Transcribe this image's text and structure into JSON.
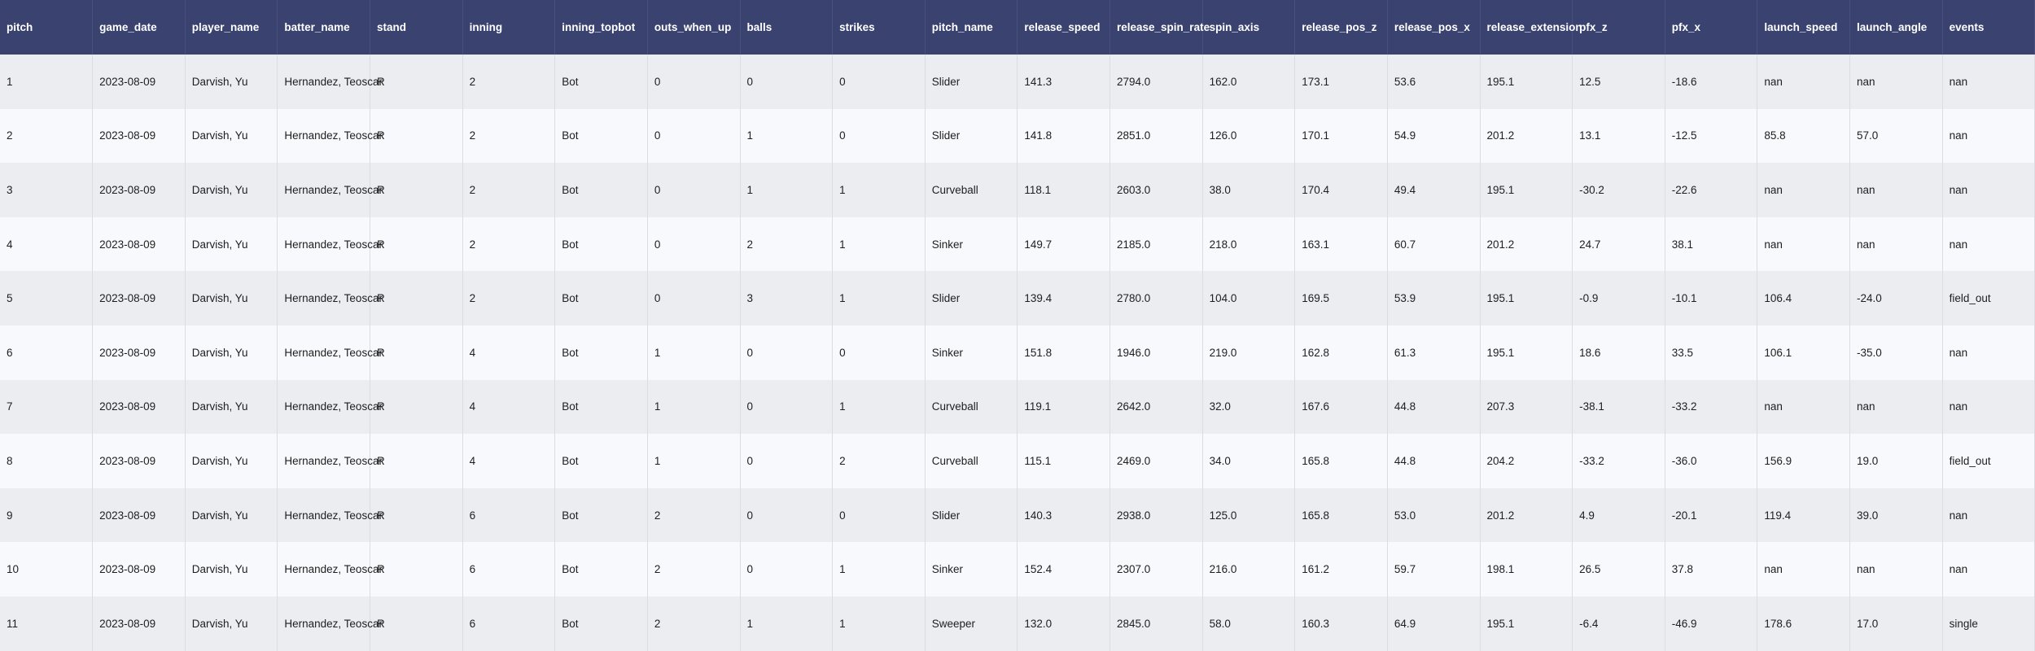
{
  "table": {
    "columns": [
      "pitch",
      "game_date",
      "player_name",
      "batter_name",
      "stand",
      "inning",
      "inning_topbot",
      "outs_when_up",
      "balls",
      "strikes",
      "pitch_name",
      "release_speed",
      "release_spin_rate",
      "spin_axis",
      "release_pos_z",
      "release_pos_x",
      "release_extension",
      "pfx_z",
      "pfx_x",
      "launch_speed",
      "launch_angle",
      "events"
    ],
    "rows": [
      [
        "1",
        "2023-08-09",
        "Darvish, Yu",
        "Hernandez, Teoscar",
        "R",
        "2",
        "Bot",
        "0",
        "0",
        "0",
        "Slider",
        "141.3",
        "2794.0",
        "162.0",
        "173.1",
        "53.6",
        "195.1",
        "12.5",
        "-18.6",
        "nan",
        "nan",
        "nan"
      ],
      [
        "2",
        "2023-08-09",
        "Darvish, Yu",
        "Hernandez, Teoscar",
        "R",
        "2",
        "Bot",
        "0",
        "1",
        "0",
        "Slider",
        "141.8",
        "2851.0",
        "126.0",
        "170.1",
        "54.9",
        "201.2",
        "13.1",
        "-12.5",
        "85.8",
        "57.0",
        "nan"
      ],
      [
        "3",
        "2023-08-09",
        "Darvish, Yu",
        "Hernandez, Teoscar",
        "R",
        "2",
        "Bot",
        "0",
        "1",
        "1",
        "Curveball",
        "118.1",
        "2603.0",
        "38.0",
        "170.4",
        "49.4",
        "195.1",
        "-30.2",
        "-22.6",
        "nan",
        "nan",
        "nan"
      ],
      [
        "4",
        "2023-08-09",
        "Darvish, Yu",
        "Hernandez, Teoscar",
        "R",
        "2",
        "Bot",
        "0",
        "2",
        "1",
        "Sinker",
        "149.7",
        "2185.0",
        "218.0",
        "163.1",
        "60.7",
        "201.2",
        "24.7",
        "38.1",
        "nan",
        "nan",
        "nan"
      ],
      [
        "5",
        "2023-08-09",
        "Darvish, Yu",
        "Hernandez, Teoscar",
        "R",
        "2",
        "Bot",
        "0",
        "3",
        "1",
        "Slider",
        "139.4",
        "2780.0",
        "104.0",
        "169.5",
        "53.9",
        "195.1",
        "-0.9",
        "-10.1",
        "106.4",
        "-24.0",
        "field_out"
      ],
      [
        "6",
        "2023-08-09",
        "Darvish, Yu",
        "Hernandez, Teoscar",
        "R",
        "4",
        "Bot",
        "1",
        "0",
        "0",
        "Sinker",
        "151.8",
        "1946.0",
        "219.0",
        "162.8",
        "61.3",
        "195.1",
        "18.6",
        "33.5",
        "106.1",
        "-35.0",
        "nan"
      ],
      [
        "7",
        "2023-08-09",
        "Darvish, Yu",
        "Hernandez, Teoscar",
        "R",
        "4",
        "Bot",
        "1",
        "0",
        "1",
        "Curveball",
        "119.1",
        "2642.0",
        "32.0",
        "167.6",
        "44.8",
        "207.3",
        "-38.1",
        "-33.2",
        "nan",
        "nan",
        "nan"
      ],
      [
        "8",
        "2023-08-09",
        "Darvish, Yu",
        "Hernandez, Teoscar",
        "R",
        "4",
        "Bot",
        "1",
        "0",
        "2",
        "Curveball",
        "115.1",
        "2469.0",
        "34.0",
        "165.8",
        "44.8",
        "204.2",
        "-33.2",
        "-36.0",
        "156.9",
        "19.0",
        "field_out"
      ],
      [
        "9",
        "2023-08-09",
        "Darvish, Yu",
        "Hernandez, Teoscar",
        "R",
        "6",
        "Bot",
        "2",
        "0",
        "0",
        "Slider",
        "140.3",
        "2938.0",
        "125.0",
        "165.8",
        "53.0",
        "201.2",
        "4.9",
        "-20.1",
        "119.4",
        "39.0",
        "nan"
      ],
      [
        "10",
        "2023-08-09",
        "Darvish, Yu",
        "Hernandez, Teoscar",
        "R",
        "6",
        "Bot",
        "2",
        "0",
        "1",
        "Sinker",
        "152.4",
        "2307.0",
        "216.0",
        "161.2",
        "59.7",
        "198.1",
        "26.5",
        "37.8",
        "nan",
        "nan",
        "nan"
      ],
      [
        "11",
        "2023-08-09",
        "Darvish, Yu",
        "Hernandez, Teoscar",
        "R",
        "6",
        "Bot",
        "2",
        "1",
        "1",
        "Sweeper",
        "132.0",
        "2845.0",
        "58.0",
        "160.3",
        "64.9",
        "195.1",
        "-6.4",
        "-46.9",
        "178.6",
        "17.0",
        "single"
      ]
    ]
  },
  "colors": {
    "header_bg": "#3a4270",
    "header_text": "#ffffff",
    "row_odd": "#ecedf1",
    "row_even": "#f8f9fc"
  }
}
